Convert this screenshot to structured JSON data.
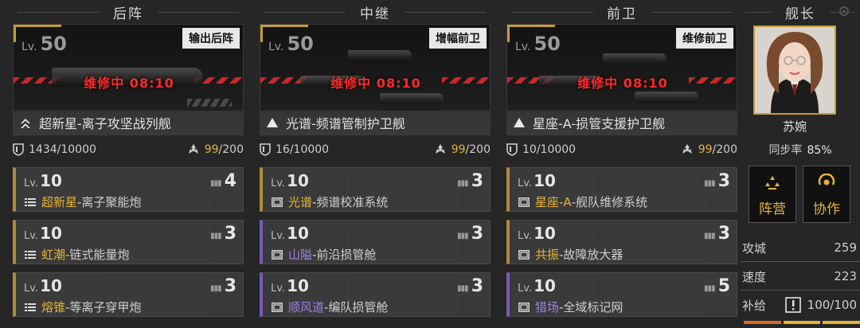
{
  "columns": [
    {
      "header": "后阵",
      "ship": {
        "level_prefix": "Lv.",
        "level": "50",
        "role": "输出后阵",
        "status": "维修中 08:10",
        "name": "超新星-离子攻坚战列舰",
        "rank_icon": "double-chevron-icon"
      },
      "hp": "1434/10000",
      "cost_used": "99",
      "cost_total": "/200",
      "modules": [
        {
          "level_prefix": "Lv.",
          "level": "10",
          "count": "4",
          "brand": "超新星",
          "rest": "-离子聚能炮",
          "icon": "weapon-icon"
        },
        {
          "level_prefix": "Lv.",
          "level": "10",
          "count": "3",
          "brand": "虹潮",
          "rest": "-链式能量炮",
          "icon": "weapon-icon"
        },
        {
          "level_prefix": "Lv.",
          "level": "10",
          "count": "3",
          "brand": "熔锥",
          "rest": "-等离子穿甲炮",
          "icon": "weapon-icon"
        }
      ]
    },
    {
      "header": "中继",
      "ship": {
        "level_prefix": "Lv.",
        "level": "50",
        "role": "增幅前卫",
        "status": "维修中 08:10",
        "name": "光谱-频谱管制护卫舰",
        "rank_icon": "triangle-icon"
      },
      "hp": "16/10000",
      "cost_used": "99",
      "cost_total": "/200",
      "modules": [
        {
          "level_prefix": "Lv.",
          "level": "10",
          "count": "3",
          "brand": "光谱",
          "rest": "-频谱校准系统",
          "icon": "system-icon"
        },
        {
          "level_prefix": "Lv.",
          "level": "10",
          "count": "3",
          "brand": "山隘",
          "rest": "-前沿损管舱",
          "icon": "system-icon"
        },
        {
          "level_prefix": "Lv.",
          "level": "10",
          "count": "3",
          "brand": "顺风道",
          "rest": "-编队损管舱",
          "icon": "system-icon"
        }
      ]
    },
    {
      "header": "前卫",
      "ship": {
        "level_prefix": "Lv.",
        "level": "50",
        "role": "维修前卫",
        "status": "维修中 08:10",
        "name": "星座-A-损管支援护卫舰",
        "rank_icon": "triangle-icon"
      },
      "hp": "10/10000",
      "cost_used": "99",
      "cost_total": "/200",
      "modules": [
        {
          "level_prefix": "Lv.",
          "level": "10",
          "count": "3",
          "brand": "星座-A",
          "rest": "-舰队维修系统",
          "icon": "system-icon"
        },
        {
          "level_prefix": "Lv.",
          "level": "10",
          "count": "3",
          "brand": "共振",
          "rest": "-故障放大器",
          "icon": "system-icon"
        },
        {
          "level_prefix": "Lv.",
          "level": "10",
          "count": "5",
          "brand": "猎场",
          "rest": "-全域标记网",
          "icon": "system-icon"
        }
      ]
    }
  ],
  "captain": {
    "header": "舰长",
    "name": "苏婉",
    "sync_label": "同步率",
    "sync_value": "85%",
    "buttons": [
      {
        "label": "阵营",
        "icon": "faction-icon"
      },
      {
        "label": "协作",
        "icon": "cooperation-icon"
      }
    ],
    "attrs": [
      {
        "label": "攻城",
        "value": "259"
      },
      {
        "label": "速度",
        "value": "223"
      }
    ],
    "supply": {
      "label": "补给",
      "value": "100/100",
      "icon": "alert-icon"
    }
  },
  "colors": {
    "accent_gold": "#e6b33a",
    "repair_red": "#ff2a2a",
    "purple": "#9d82e6"
  },
  "settings_icon": "gear-icon"
}
